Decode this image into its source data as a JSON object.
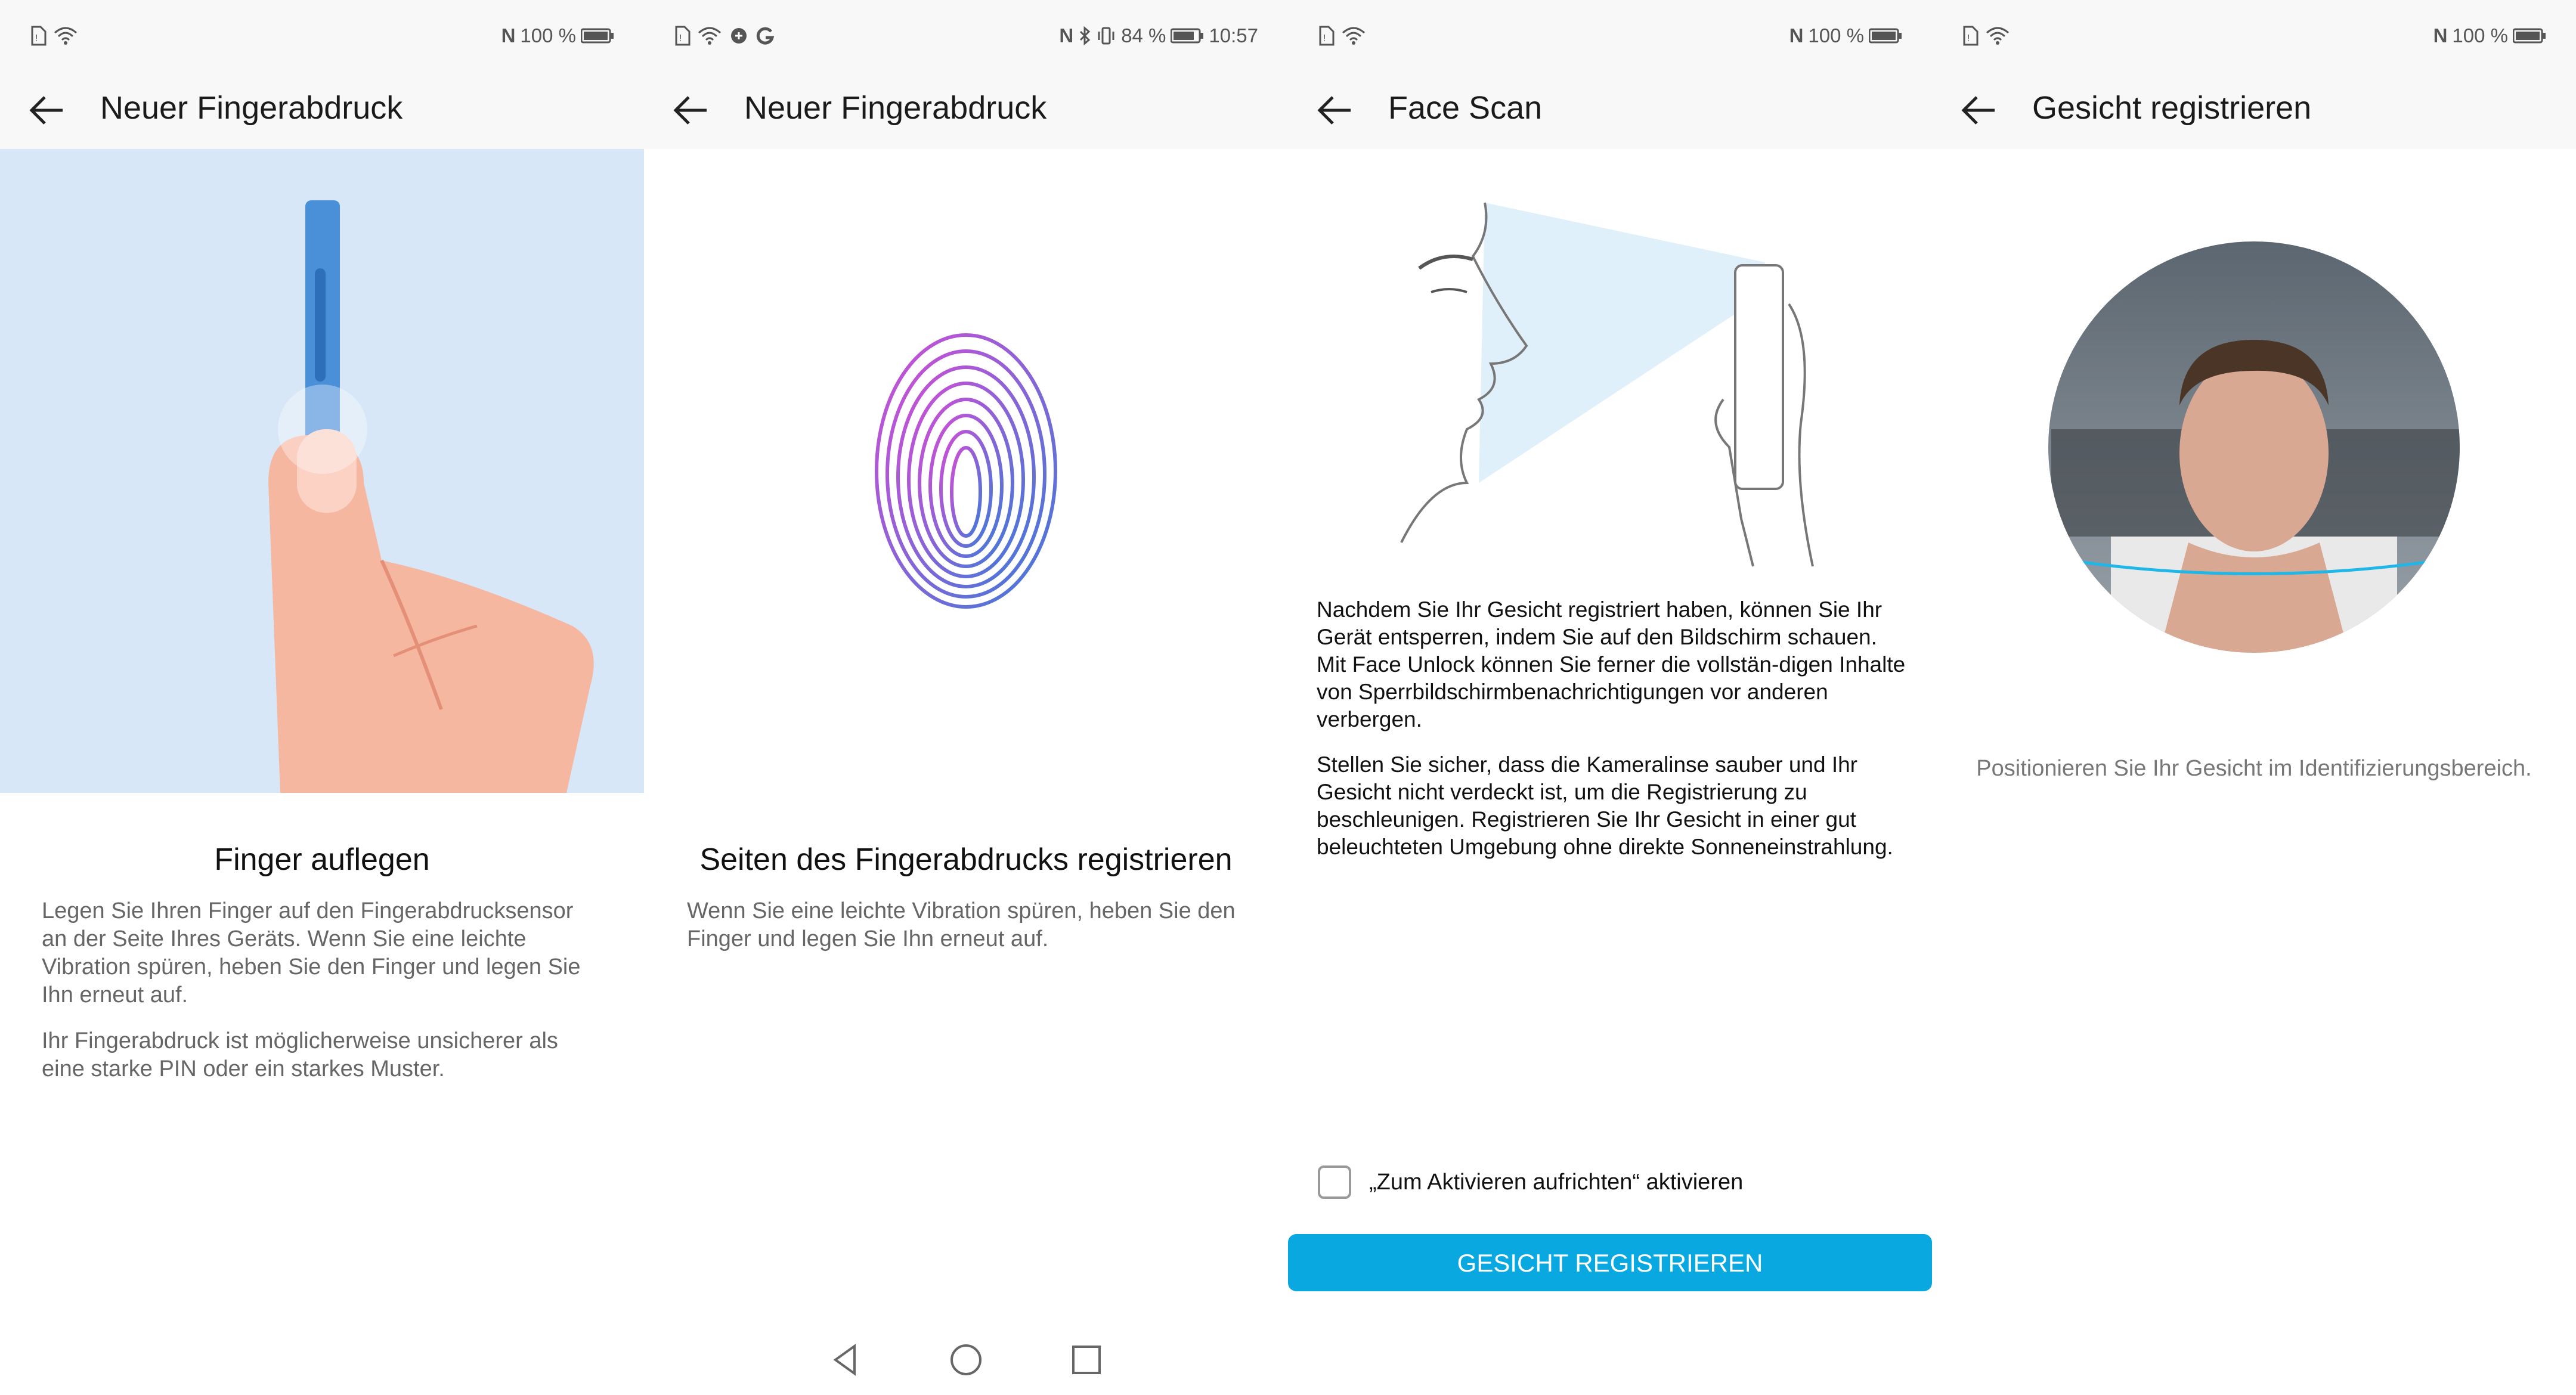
{
  "panels": [
    {
      "status": {
        "left_icons": [
          "sim-icon",
          "wifi-icon"
        ],
        "nfc": "N",
        "battery_text": "100 %",
        "time": ""
      },
      "appbar": {
        "title": "Neuer Fingerabdruck"
      },
      "heading": "Finger auflegen",
      "paragraphs": [
        "Legen Sie Ihren Finger auf den Fingerabdrucksensor an der Seite Ihres Geräts. Wenn Sie eine leichte Vibration spüren, heben Sie den Finger und legen Sie Ihn erneut auf.",
        "Ihr Fingerabdruck ist möglicherweise unsicherer als eine starke PIN oder ein starkes Muster."
      ]
    },
    {
      "status": {
        "left_icons": [
          "sim-icon",
          "wifi-icon",
          "data-saver-icon",
          "google-icon"
        ],
        "nfc": "N",
        "battery_text": "84 %",
        "time": "10:57"
      },
      "appbar": {
        "title": "Neuer Fingerabdruck"
      },
      "heading": "Seiten des Fingerabdrucks registrieren",
      "paragraphs": [
        "Wenn Sie eine leichte Vibration spüren, heben Sie den Finger und legen Sie Ihn erneut auf."
      ],
      "navbar": [
        "back-nav-icon",
        "home-nav-icon",
        "recents-nav-icon"
      ]
    },
    {
      "status": {
        "left_icons": [
          "sim-icon",
          "wifi-icon"
        ],
        "nfc": "N",
        "battery_text": "100 %",
        "time": ""
      },
      "appbar": {
        "title": "Face Scan"
      },
      "paragraphs": [
        "Nachdem Sie Ihr Gesicht registriert haben, können Sie Ihr Gerät entsperren, indem Sie auf den Bildschirm schauen. Mit Face Unlock können Sie ferner die vollstän-digen Inhalte von Sperrbildschirmbenachrichtigungen vor anderen verbergen.",
        "Stellen Sie sicher, dass die Kameralinse sauber und Ihr Gesicht nicht verdeckt ist, um die Registrierung zu beschleunigen. Registrieren Sie Ihr Gesicht in einer gut beleuchteten Umgebung ohne direkte Sonneneinstrahlung."
      ],
      "checkbox_label": "„Zum Aktivieren aufrichten“ aktivieren",
      "button_label": "GESICHT REGISTRIEREN"
    },
    {
      "status": {
        "left_icons": [
          "sim-icon",
          "wifi-icon"
        ],
        "nfc": "N",
        "battery_text": "100 %",
        "time": ""
      },
      "appbar": {
        "title": "Gesicht registrieren"
      },
      "hint": "Positionieren Sie Ihr Gesicht im Identifizierungsbereich."
    }
  ],
  "colors": {
    "accent": "#0aa8e0",
    "illustration_bg": "#d7e7f7",
    "skin": "#f6b7a0",
    "statusbar_bg": "#f8f8f8"
  }
}
